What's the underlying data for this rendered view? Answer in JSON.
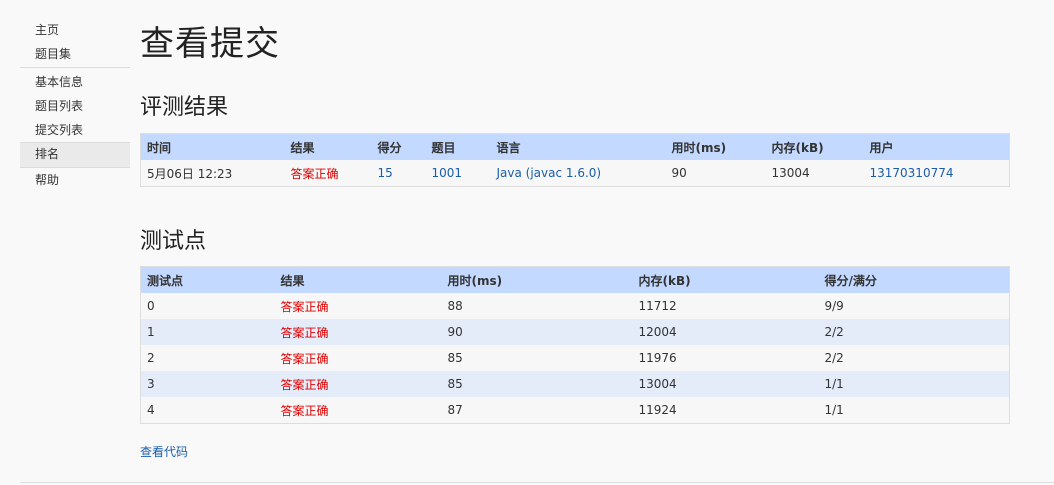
{
  "nav": {
    "group1": [
      {
        "label": "主页"
      },
      {
        "label": "题目集"
      }
    ],
    "group2": [
      {
        "label": "基本信息"
      },
      {
        "label": "题目列表"
      },
      {
        "label": "提交列表"
      },
      {
        "label": "排名"
      },
      {
        "label": "帮助"
      }
    ]
  },
  "page_title": "查看提交",
  "result_section": {
    "heading": "评测结果",
    "headers": [
      "时间",
      "结果",
      "得分",
      "题目",
      "语言",
      "用时(ms)",
      "内存(kB)",
      "用户"
    ],
    "row": {
      "time": "5月06日 12:23",
      "result": "答案正确",
      "score": "15",
      "problem": "1001",
      "language": "Java (javac 1.6.0)",
      "time_ms": "90",
      "memory_kb": "13004",
      "user": "13170310774"
    }
  },
  "tests_section": {
    "heading": "测试点",
    "headers": [
      "测试点",
      "结果",
      "用时(ms)",
      "内存(kB)",
      "得分/满分"
    ],
    "rows": [
      {
        "id": "0",
        "result": "答案正确",
        "time_ms": "88",
        "memory_kb": "11712",
        "score": "9/9"
      },
      {
        "id": "1",
        "result": "答案正确",
        "time_ms": "90",
        "memory_kb": "12004",
        "score": "2/2"
      },
      {
        "id": "2",
        "result": "答案正确",
        "time_ms": "85",
        "memory_kb": "11976",
        "score": "2/2"
      },
      {
        "id": "3",
        "result": "答案正确",
        "time_ms": "85",
        "memory_kb": "13004",
        "score": "1/1"
      },
      {
        "id": "4",
        "result": "答案正确",
        "time_ms": "87",
        "memory_kb": "11924",
        "score": "1/1"
      }
    ]
  },
  "view_code_label": "查看代码",
  "colors": {
    "header_bg": "#c3d9ff",
    "accepted": "#dd0000",
    "link": "#1a5ea8",
    "row_alt": "#e5ecf9"
  }
}
